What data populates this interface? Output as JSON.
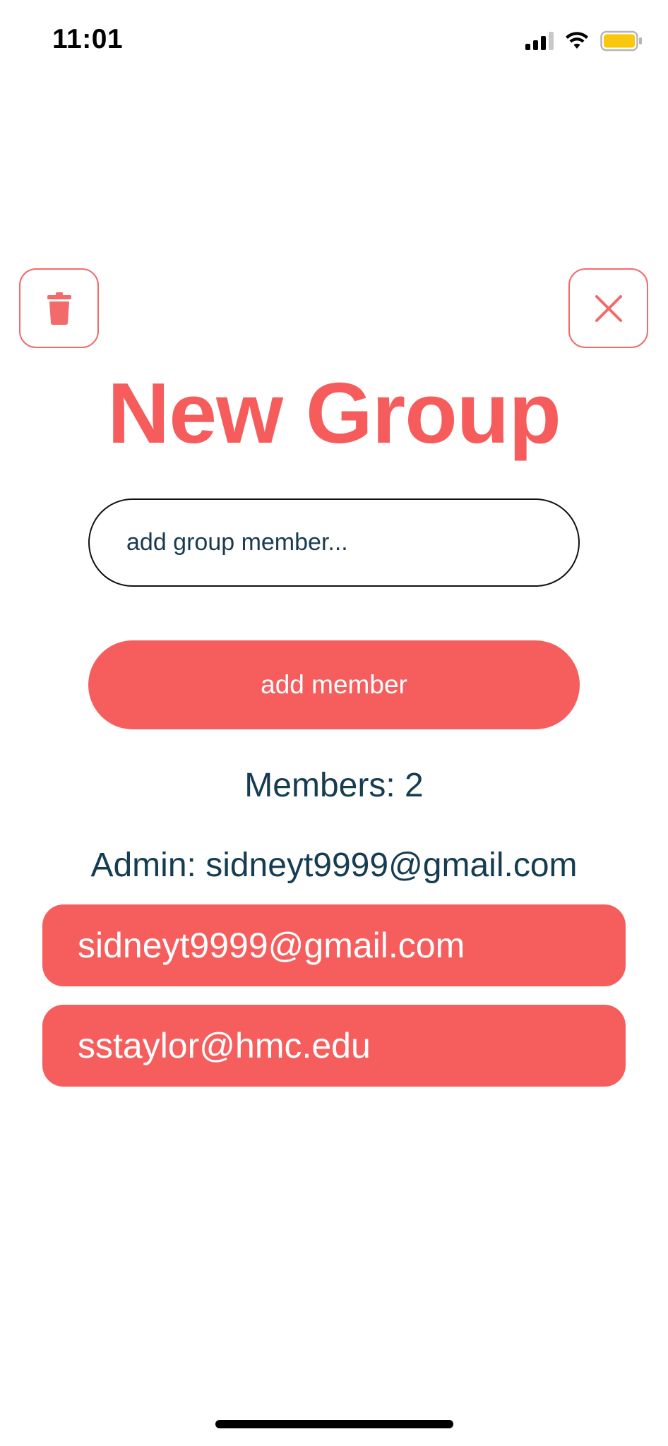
{
  "status_bar": {
    "time": "11:01"
  },
  "header": {
    "delete_icon": "trash-icon",
    "close_icon": "close-icon",
    "title": "New Group"
  },
  "form": {
    "member_input_placeholder": "add group member...",
    "member_input_value": "",
    "add_button_label": "add member"
  },
  "info": {
    "members_count_text": "Members: 2",
    "admin_text": "Admin: sidneyt9999@gmail.com"
  },
  "members": [
    {
      "email": "sidneyt9999@gmail.com"
    },
    {
      "email": "sstaylor@hmc.edu"
    }
  ],
  "colors": {
    "accent": "#f65e5e",
    "text_dark": "#163c52",
    "battery": "#f9c80e"
  }
}
